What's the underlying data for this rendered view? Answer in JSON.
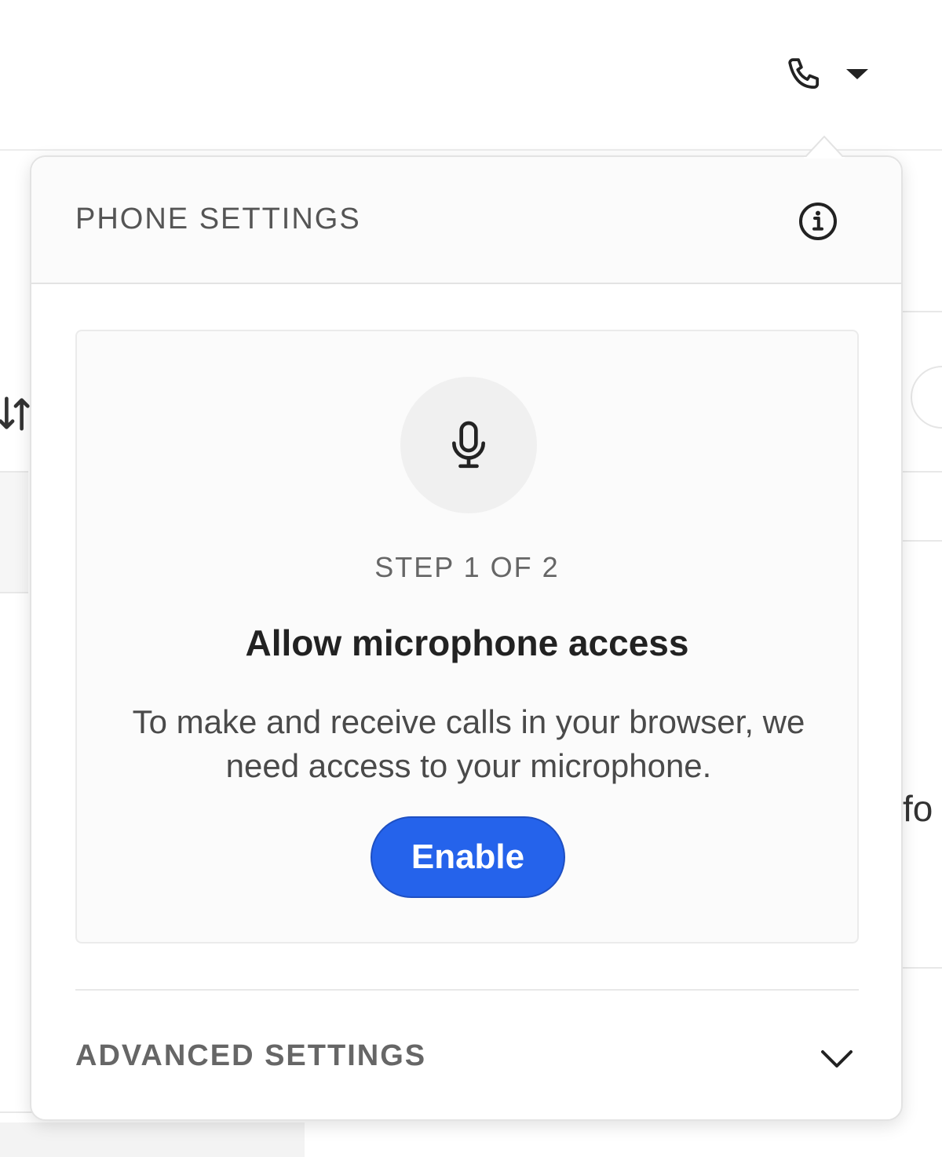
{
  "colors": {
    "accent": "#2563eb",
    "text_primary": "#222222",
    "text_muted": "#666666",
    "border": "#e3e3e3"
  },
  "topbar": {
    "phone_icon": "phone-icon",
    "caret_icon": "caret-down-icon"
  },
  "background": {
    "partial_text": "fo"
  },
  "popover": {
    "title": "PHONE SETTINGS",
    "info_icon": "info-icon",
    "step": {
      "icon": "microphone-icon",
      "label": "STEP 1 OF 2",
      "heading": "Allow microphone access",
      "description": "To make and receive calls in your browser, we need access to your microphone.",
      "button_label": "Enable"
    },
    "advanced": {
      "label": "ADVANCED SETTINGS",
      "icon": "chevron-down-icon"
    }
  }
}
